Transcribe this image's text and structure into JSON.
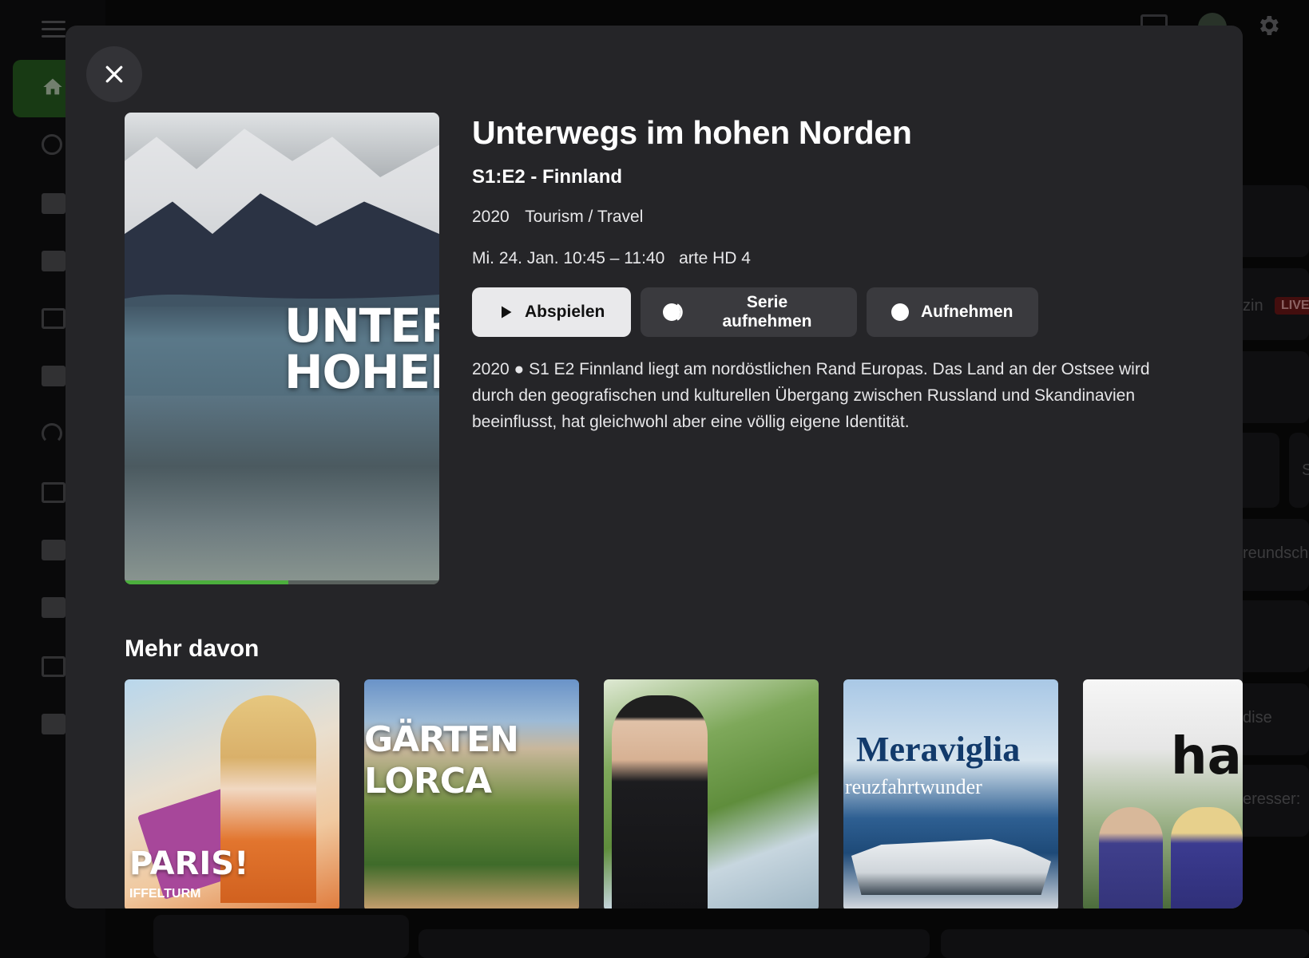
{
  "modal": {
    "title": "Unterwegs im hohen Norden",
    "episode": "S1:E2 - Finnland",
    "year": "2020",
    "genre": "Tourism / Travel",
    "airing_time": "Mi. 24. Jan. 10:45 – 11:40",
    "channel": "arte HD 4",
    "poster_text_line1": "UNTER",
    "poster_text_line2": "HOHEN",
    "watch_progress_percent": 52,
    "actions": {
      "play": "Abspielen",
      "record_series": "Serie aufnehmen",
      "record": "Aufnehmen"
    },
    "description": "2020 ● S1 E2 Finnland liegt am nordöstlichen Rand Europas. Das Land an der Ostsee wird durch den geografischen und kulturellen Übergang zwischen Russland und Skandinavien beeinflusst, hat gleichwohl aber eine völlig eigene Identität."
  },
  "more": {
    "heading": "Mehr davon",
    "items": [
      {
        "label": "PARIS!",
        "sub": "IFFELTURM"
      },
      {
        "label": "GÄRTEN\nLORCA"
      },
      {
        "label": ""
      },
      {
        "label": "Meraviglia",
        "sub": "reuzfahrtwunder"
      },
      {
        "label": "han"
      }
    ]
  },
  "background": {
    "live_badge": "LIVE",
    "snippets": [
      "zin",
      "reundsch",
      "dise",
      "eresser:",
      "S"
    ]
  },
  "colors": {
    "accent_green": "#4caf3d",
    "modal_bg": "#252528",
    "primary_button": "#e9e9eb",
    "secondary_button": "#3a3a3e"
  },
  "icons": {
    "close": "close-icon",
    "play": "play-icon",
    "record_series": "record-series-icon",
    "record": "record-icon"
  }
}
